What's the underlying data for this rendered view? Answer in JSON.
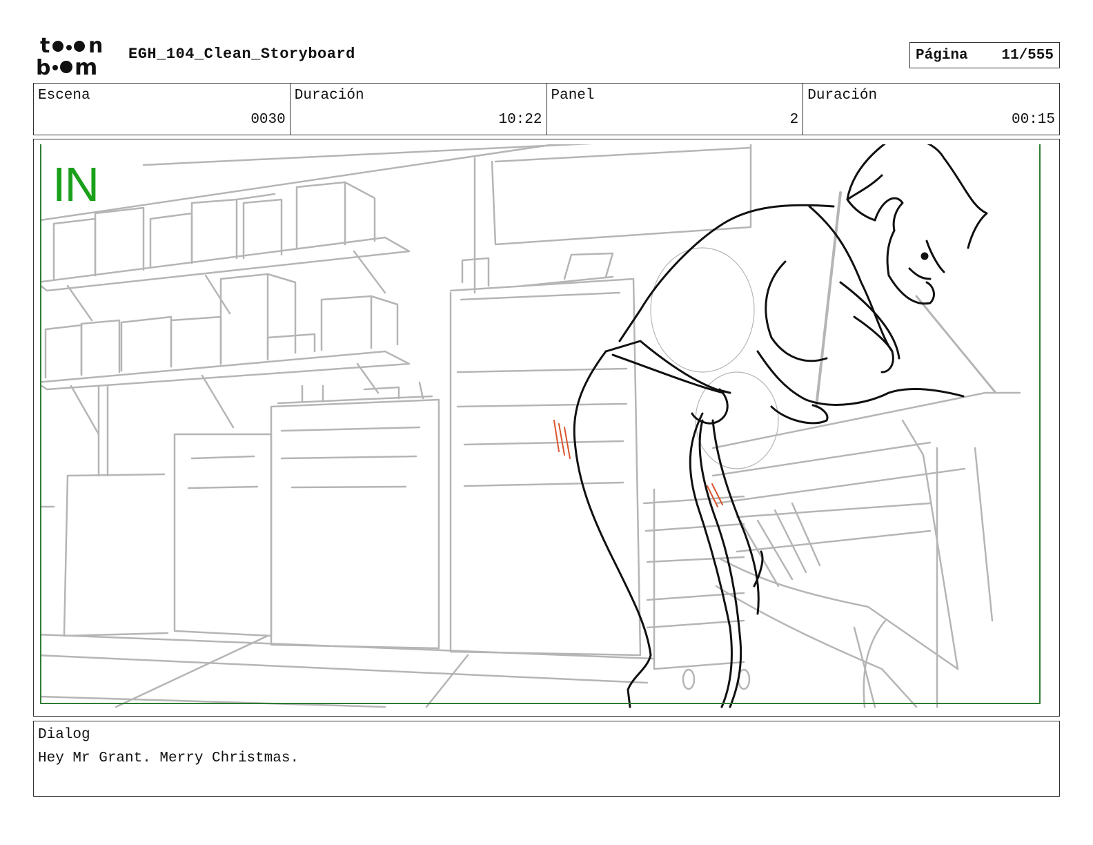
{
  "header": {
    "logo_text": "toonboom",
    "title": "EGH_104_Clean_Storyboard",
    "page_label": "Página",
    "page_value": "11/555"
  },
  "info": {
    "scene_label": "Escena",
    "scene_value": "0030",
    "scene_duration_label": "Duración",
    "scene_duration_value": "10:22",
    "panel_label": "Panel",
    "panel_value": "2",
    "panel_duration_label": "Duración",
    "panel_duration_value": "00:15"
  },
  "panel": {
    "transition_label": "IN",
    "transition_color": "#1aa01a",
    "frame_color": "#2e7d32"
  },
  "dialog": {
    "label": "Dialog",
    "text": "Hey Mr Grant. Merry Christmas."
  }
}
